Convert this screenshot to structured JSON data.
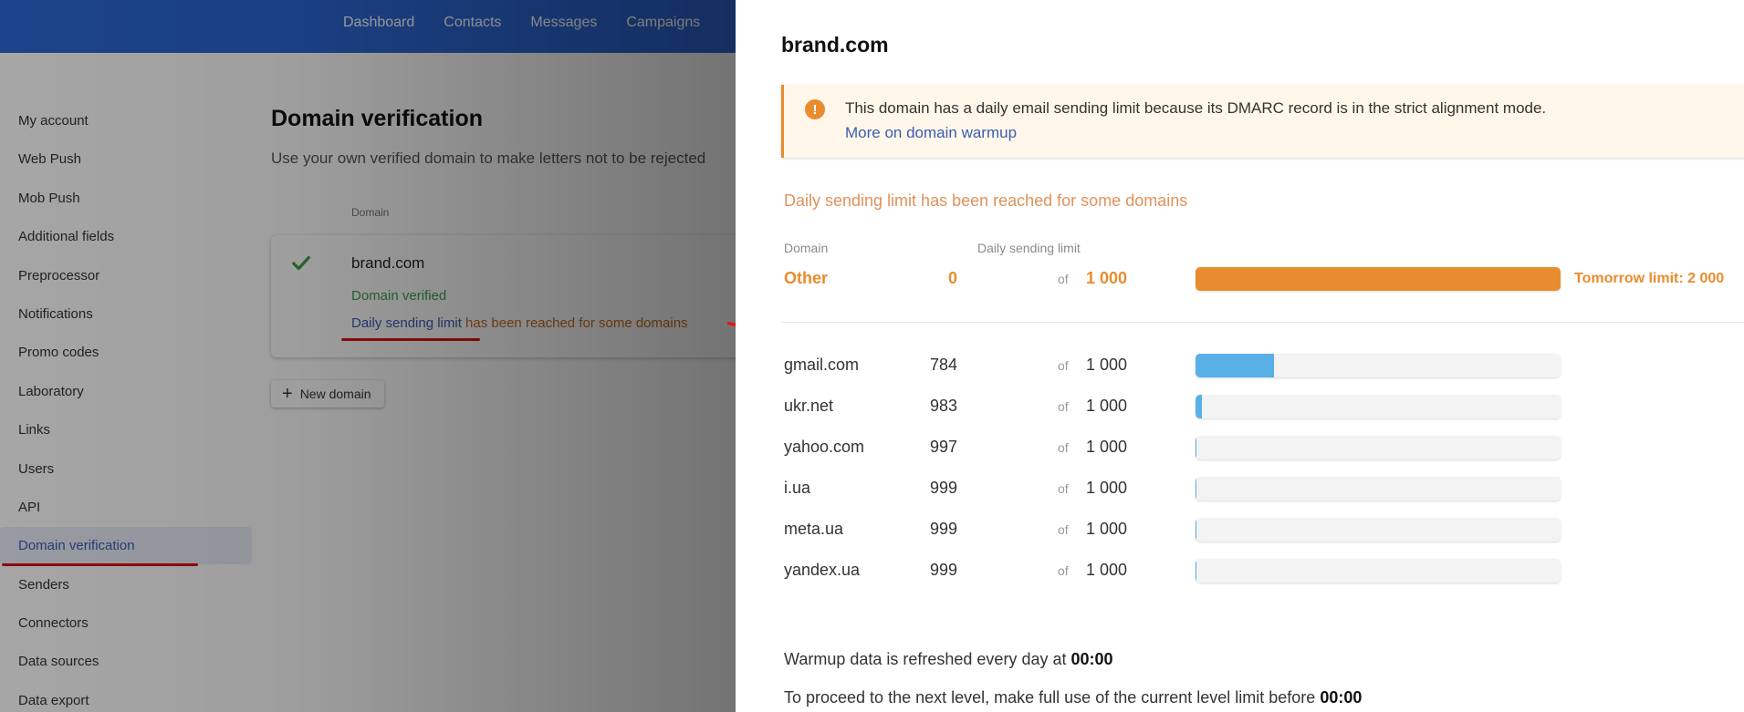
{
  "topnav": [
    "Dashboard",
    "Contacts",
    "Messages",
    "Campaigns"
  ],
  "sidebar": {
    "items": [
      {
        "label": "My account"
      },
      {
        "label": "Web Push"
      },
      {
        "label": "Mob Push"
      },
      {
        "label": "Additional fields"
      },
      {
        "label": "Preprocessor"
      },
      {
        "label": "Notifications"
      },
      {
        "label": "Promo codes"
      },
      {
        "label": "Laboratory"
      },
      {
        "label": "Links"
      },
      {
        "label": "Users"
      },
      {
        "label": "API"
      },
      {
        "label": "Domain verification",
        "active": true
      },
      {
        "label": "Senders"
      },
      {
        "label": "Connectors"
      },
      {
        "label": "Data sources"
      },
      {
        "label": "Data export"
      }
    ]
  },
  "main": {
    "title": "Domain verification",
    "subtitle": "Use your own verified domain to make letters not to be rejected",
    "column_header": "Domain",
    "card": {
      "domain": "brand.com",
      "status": "Domain verified",
      "limit_link": "Daily sending limit",
      "limit_text": " has been reached for some domains"
    },
    "new_domain_label": "New domain"
  },
  "panel": {
    "title": "brand.com",
    "notice": {
      "text": "This domain has a daily email sending limit because its DMARC record is in the strict alignment mode.",
      "link": "More on domain warmup"
    },
    "limit_reached": "Daily sending limit has been reached for some domains",
    "headers": {
      "domain": "Domain",
      "limit": "Daily sending limit"
    },
    "of_label": "of",
    "other": {
      "domain": "Other",
      "used": "0",
      "limit": "1 000",
      "remaining_fraction": 1.0,
      "tomorrow": "Tomorrow limit:  2 000"
    },
    "rows": [
      {
        "domain": "gmail.com",
        "used": "784",
        "limit": "1 000",
        "remaining_fraction": 0.216
      },
      {
        "domain": "ukr.net",
        "used": "983",
        "limit": "1 000",
        "remaining_fraction": 0.017
      },
      {
        "domain": "yahoo.com",
        "used": "997",
        "limit": "1 000",
        "remaining_fraction": 0.003
      },
      {
        "domain": "i.ua",
        "used": "999",
        "limit": "1 000",
        "remaining_fraction": 0.001
      },
      {
        "domain": "meta.ua",
        "used": "999",
        "limit": "1 000",
        "remaining_fraction": 0.001
      },
      {
        "domain": "yandex.ua",
        "used": "999",
        "limit": "1 000",
        "remaining_fraction": 0.001
      }
    ],
    "footer": {
      "refresh_text": "Warmup data is refreshed every day at ",
      "refresh_time": "00:00",
      "proceed_text": "To proceed to the next level, make full use of the current level limit before ",
      "proceed_time": "00:00"
    }
  },
  "colors": {
    "brand_blue": "#2b66d3",
    "accent_orange": "#e88c2e",
    "bar_blue": "#58b0e6",
    "success_green": "#3aa046",
    "annotation_red": "#e01010"
  }
}
